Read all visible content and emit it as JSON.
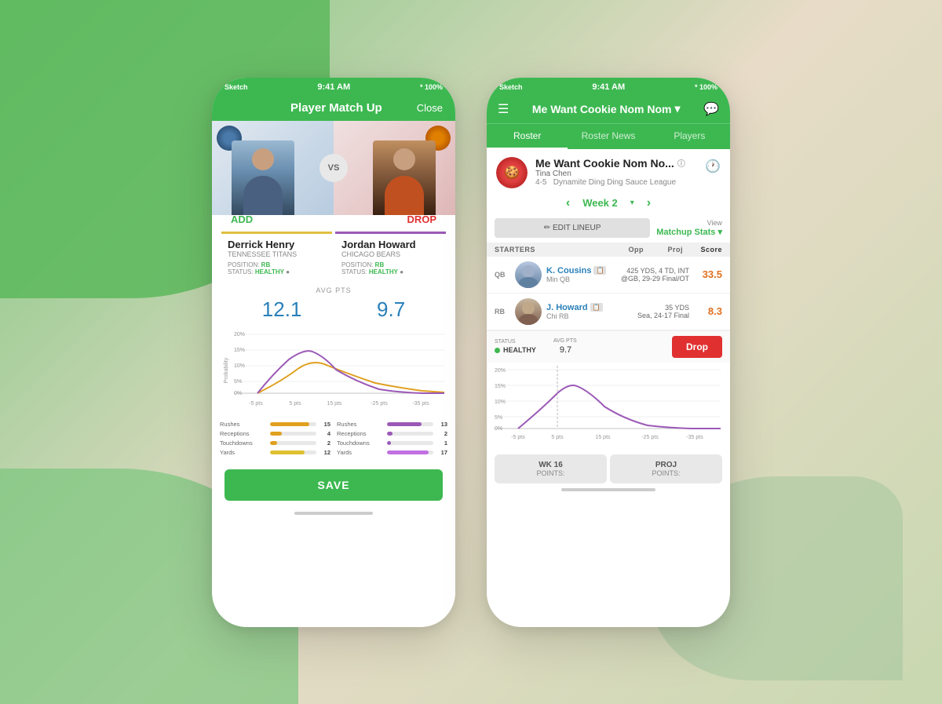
{
  "background": {
    "colors": [
      "#7bc67e",
      "#e8dcc8",
      "#c8d8b0"
    ]
  },
  "left_phone": {
    "status_bar": {
      "signal": "Sketch",
      "wifi": "wifi",
      "time": "9:41 AM",
      "bluetooth": "* 100%"
    },
    "nav": {
      "title": "Player Match Up",
      "close": "Close"
    },
    "matchup": {
      "vs_label": "VS",
      "add_label": "ADD",
      "drop_label": "DROP"
    },
    "player_left": {
      "name": "Derrick Henry",
      "team": "TENNESSEE TITANS",
      "position": "RB",
      "status": "HEALTHY"
    },
    "player_right": {
      "name": "Jordan Howard",
      "team": "CHICAGO BEARS",
      "position": "RB",
      "status": "HEALTHY"
    },
    "avg_pts_label": "AVG PTS",
    "pts_left": "12.1",
    "pts_right": "9.7",
    "chart": {
      "y_label": "Probability",
      "x_ticks": [
        "-5 pts",
        "5 pts",
        "15 pts",
        "-25 pts",
        "-35 pts"
      ],
      "y_ticks": [
        "20%",
        "15%",
        "10%",
        "5%",
        "0%"
      ]
    },
    "stats_left": {
      "rushes": {
        "label": "Rushes",
        "val": "15",
        "pct": 0.85
      },
      "receptions": {
        "label": "Receptions",
        "val": "4",
        "pct": 0.25
      },
      "touchdowns": {
        "label": "Touchdowns",
        "val": "2",
        "pct": 0.15
      },
      "yards": {
        "label": "Yards",
        "val": "12",
        "pct": 0.75
      }
    },
    "stats_right": {
      "rushes": {
        "label": "Rushes",
        "val": "13",
        "pct": 0.75
      },
      "receptions": {
        "label": "Receptions",
        "val": "2",
        "pct": 0.12
      },
      "touchdowns": {
        "label": "Touchdowns",
        "val": "1",
        "pct": 0.08
      },
      "yards": {
        "label": "Yards",
        "val": "17",
        "pct": 0.9
      }
    },
    "save_btn": "SAVE"
  },
  "right_phone": {
    "status_bar": {
      "signal": "Sketch",
      "wifi": "wifi",
      "time": "9:41 AM",
      "bluetooth": "* 100%"
    },
    "nav": {
      "team_name": "Me Want Cookie Nom Nom",
      "dropdown_arrow": "▾"
    },
    "tabs": [
      "Roster",
      "Roster News",
      "Players"
    ],
    "active_tab": "Roster",
    "team_info": {
      "name": "Me Want Cookie Nom No...",
      "owner": "Tina Chen",
      "record": "4-5",
      "league": "Dynamite Ding Ding Sauce League"
    },
    "week_nav": {
      "prev": "‹",
      "label": "Week 2",
      "next": "›"
    },
    "actions": {
      "edit_lineup": "✏ EDIT LINEUP",
      "view_label": "View",
      "matchup_stats": "Matchup Stats ▾"
    },
    "starters_header": {
      "starters": "STARTERS",
      "opp": "Opp",
      "proj": "Proj",
      "score": "Score"
    },
    "players": [
      {
        "pos": "QB",
        "name": "K. Cousins",
        "team": "Min QB",
        "opp_stats": "425 YDS, 4 TD, INT",
        "opp_game": "@GB, 29-29 Final/OT",
        "score": "33.5"
      },
      {
        "pos": "RB",
        "name": "J. Howard",
        "team": "Chi RB",
        "opp_stats": "35 YDS",
        "opp_game": "Sea, 24-17 Final",
        "score": "8.3"
      }
    ],
    "player_detail": {
      "status_label": "STATUS",
      "status_value": "HEALTHY",
      "avg_label": "AVG PTS",
      "avg_value": "9.7",
      "drop_btn": "Drop"
    },
    "chart": {
      "y_label": "Probability",
      "y_ticks": [
        "20%",
        "15%",
        "10%",
        "5%",
        "0%"
      ],
      "x_ticks": [
        "-5 pts",
        "5 pts",
        "15 pts",
        "-25 pts",
        "-35 pts"
      ]
    },
    "bottom_stats": [
      {
        "title": "WK 16",
        "sub": "POINTS:"
      },
      {
        "title": "PROJ",
        "sub": "POINTS:"
      }
    ]
  }
}
